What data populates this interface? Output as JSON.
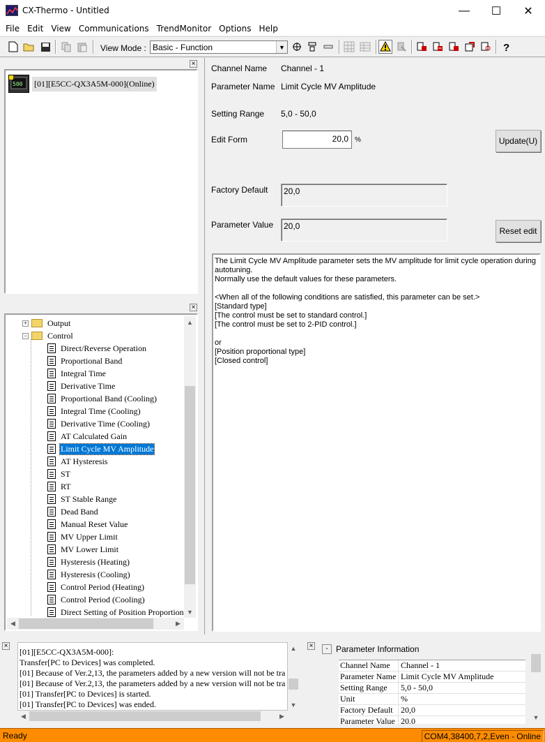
{
  "window": {
    "title": "CX-Thermo - Untitled",
    "minimize": "—",
    "maximize": "☐",
    "close": "✕"
  },
  "menu": [
    "File",
    "Edit",
    "View",
    "Communications",
    "TrendMonitor",
    "Options",
    "Help"
  ],
  "toolbar": {
    "view_mode_label": "View Mode :",
    "view_mode_value": "Basic - Function"
  },
  "device": {
    "label": "[01][E5CC-QX3A5M-000](Online)"
  },
  "tree": {
    "folders": [
      {
        "label": "Output",
        "expander": "+"
      },
      {
        "label": "Control",
        "expander": "−"
      }
    ],
    "items": [
      "Direct/Reverse Operation",
      "Proportional Band",
      "Integral Time",
      "Derivative Time",
      "Proportional Band (Cooling)",
      "Integral Time (Cooling)",
      "Derivative Time (Cooling)",
      "AT Calculated Gain",
      "Limit Cycle MV Amplitude",
      "AT Hysteresis",
      "ST",
      "RT",
      "ST Stable Range",
      "Dead Band",
      "Manual Reset Value",
      "MV Upper Limit",
      "MV Lower Limit",
      "Hysteresis (Heating)",
      "Hysteresis (Cooling)",
      "Control Period (Heating)",
      "Control Period (Cooling)",
      "Direct Setting of Position Proportional"
    ],
    "selected_index": 8
  },
  "param": {
    "channel_name_label": "Channel Name",
    "channel_name": "Channel - 1",
    "parameter_name_label": "Parameter Name",
    "parameter_name": "Limit Cycle MV Amplitude",
    "setting_range_label": "Setting Range",
    "setting_range": "5,0 - 50,0",
    "edit_form_label": "Edit Form",
    "edit_value": "20,0",
    "unit": "%",
    "update_button": "Update(U)",
    "factory_default_label": "Factory Default",
    "factory_default": "20,0",
    "parameter_value_label": "Parameter Value",
    "parameter_value": "20,0",
    "reset_button": "Reset edit",
    "description": "The Limit Cycle MV Amplitude parameter sets the MV amplitude for limit cycle operation during autotuning.\nNormally use the default values for these parameters.\n\n<When all of the following conditions are satisfied, this parameter can be set.>\n[Standard type]\n[The control must be set to standard control.]\n[The control must be set to 2-PID control.]\n\nor\n[Position proportional type]\n[Closed control]"
  },
  "log": {
    "lines": [
      "[01][E5CC-QX3A5M-000]:",
      "        Transfer[PC to Devices] was completed.",
      "[01] Because of Ver.2,13, the parameters added by a new version will not be tra",
      "[01] Because of Ver.2,13, the parameters added by a new version will not be tra",
      "[01] Transfer[PC to Devices] is started.",
      "[01] Transfer[PC to Devices] was ended."
    ]
  },
  "info": {
    "title": "Parameter Information",
    "collapse": "-",
    "rows": [
      {
        "key": "Channel Name",
        "value": "Channel - 1"
      },
      {
        "key": "Parameter Name",
        "value": "Limit Cycle MV Amplitude"
      },
      {
        "key": "Setting Range",
        "value": "5,0 - 50,0"
      },
      {
        "key": "Unit",
        "value": "%"
      },
      {
        "key": "Factory Default",
        "value": "20,0"
      },
      {
        "key": "Parameter Value",
        "value": "20,0"
      }
    ]
  },
  "status": {
    "left": "Ready",
    "right": "COM4,38400,7,2,Even - Online"
  },
  "colors": {
    "status_bar": "#ff8c00",
    "selection": "#0078d7"
  }
}
